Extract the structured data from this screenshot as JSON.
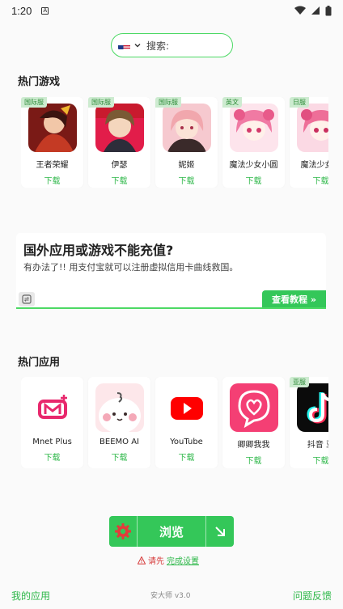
{
  "status_bar": {
    "time": "1:20",
    "icons": [
      "notification-icon",
      "wifi-icon",
      "signal-icon",
      "battery-icon"
    ]
  },
  "search": {
    "region_flag": "flag-us-icon",
    "placeholder": "搜索:"
  },
  "hot_games": {
    "title": "热门游戏",
    "items": [
      {
        "name": "王者荣耀",
        "download": "下载",
        "tag": "国际服",
        "icon": "game-icon"
      },
      {
        "name": "伊瑟",
        "download": "下载",
        "tag": "国际服",
        "icon": "game-icon"
      },
      {
        "name": "妮姬",
        "download": "下载",
        "tag": "国际服",
        "icon": "game-icon"
      },
      {
        "name": "魔法少女小圆",
        "download": "下载",
        "tag": "英文",
        "icon": "game-icon"
      },
      {
        "name": "魔法少女小",
        "download": "下载",
        "tag": "日服",
        "icon": "game-icon"
      }
    ]
  },
  "promo": {
    "title": "国外应用或游戏不能充值?",
    "text": "有办法了!! 用支付宝就可以注册虚拟信用卡曲线救国。",
    "button": "查看教程 »"
  },
  "hot_apps": {
    "title": "热门应用",
    "items": [
      {
        "name": "Mnet Plus",
        "download": "下载",
        "tag": "",
        "icon": "mnet-plus-icon"
      },
      {
        "name": "BEEMO AI",
        "download": "下载",
        "tag": "",
        "icon": "beemo-ai-icon"
      },
      {
        "name": "YouTube",
        "download": "下载",
        "tag": "",
        "icon": "youtube-icon"
      },
      {
        "name": "卿卿我我",
        "download": "下载",
        "tag": "",
        "icon": "heart-chat-icon"
      },
      {
        "name": "抖音 亚",
        "download": "下载",
        "tag": "亚服",
        "icon": "tiktok-icon"
      }
    ]
  },
  "browse": {
    "label": "浏览"
  },
  "warning": {
    "text": "请先",
    "link": "完成设置"
  },
  "footer": {
    "left": "我的应用",
    "version": "安大师 v3.0",
    "right": "问题反馈"
  },
  "colors": {
    "accent": "#34c759",
    "accent_text": "#2fb84a",
    "warning": "#d63a3a",
    "tag_bg": "#cdebd0"
  }
}
